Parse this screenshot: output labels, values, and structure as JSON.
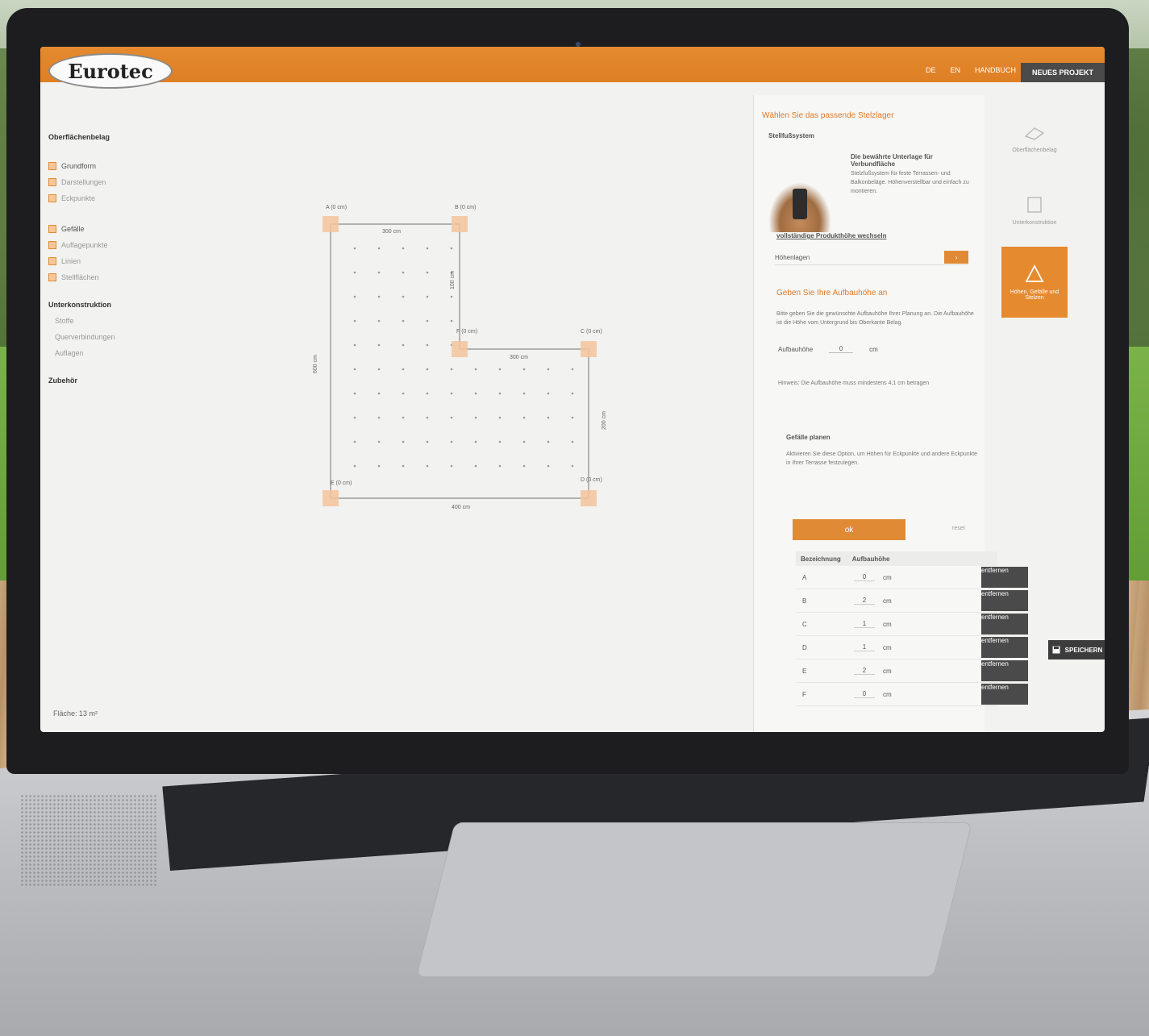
{
  "brand": {
    "logo_text": "Eurotec",
    "accent": "#e58a2f"
  },
  "header": {
    "links": [
      "DE",
      "EN",
      "HANDBUCH"
    ],
    "new_project": "NEUES PROJEKT"
  },
  "nav": {
    "sections": [
      {
        "heading": "Oberflächenbelag",
        "items": []
      },
      {
        "heading": "",
        "items": [
          {
            "label": "Grundform",
            "active": true
          },
          {
            "label": "Darstellungen",
            "active": false
          },
          {
            "label": "Eckpunkte",
            "active": false
          }
        ]
      },
      {
        "heading": "",
        "items": [
          {
            "label": "Gefälle",
            "active": true
          },
          {
            "label": "Auflagepunkte",
            "active": false
          },
          {
            "label": "Linien",
            "active": false
          },
          {
            "label": "Stellflächen",
            "active": false
          }
        ]
      },
      {
        "heading": "Unterkonstruktion",
        "items": [
          {
            "label": "Stoffe",
            "active": false
          },
          {
            "label": "Querverbindungen",
            "active": false
          },
          {
            "label": "Auflagen",
            "active": false
          }
        ]
      },
      {
        "heading": "Zubehör",
        "items": []
      }
    ],
    "area_label": "Fläche: 13 m²"
  },
  "drawing": {
    "corner_labels": [
      "A (0 cm)",
      "B (0 cm)",
      "C (0 cm)",
      "D (0 cm)",
      "E (0 cm)",
      "F (0 cm)"
    ],
    "dimensions": [
      "300 cm",
      "100 cm",
      "300 cm",
      "200 cm",
      "600 cm",
      "400 cm"
    ]
  },
  "panel": {
    "title": "Wählen Sie das passende Stelzlager",
    "subtitle": "Stellfußsystem",
    "product_heading": "Die bewährte Unterlage für Verbundfläche",
    "product_text": "Stelzfußsystem für feste Terrassen- und Balkonbeläge. Höhenverstellbar und einfach zu montieren.",
    "link": "vollständige Produkthöhe wechseln",
    "select_label": "Höhenlagen",
    "section2_title": "Geben Sie Ihre Aufbauhöhe an",
    "section2_text": "Bitte geben Sie die gewünschte Aufbauhöhe Ihrer Planung an. Die Aufbauhöhe ist die Höhe vom Untergrund bis Oberkante Belag.",
    "height_label": "Aufbauhöhe",
    "height_value": "0",
    "height_unit": "cm",
    "note": "Hinweis: Die Aufbauhöhe muss mindestens 4,1 cm betragen",
    "gefaelle_title": "Gefälle planen",
    "gefaelle_text": "Aktivieren Sie diese Option, um Höhen für Eckpunkte und andere Eckpunkte in Ihrer Terrasse festzulegen.",
    "plan_button": "ok",
    "reset_button": "reset",
    "table_headers": [
      "Bezeichnung",
      "Aufbauhöhe"
    ],
    "rows": [
      {
        "name": "A",
        "value": "0",
        "unit": "cm"
      },
      {
        "name": "B",
        "value": "2",
        "unit": "cm"
      },
      {
        "name": "C",
        "value": "1",
        "unit": "cm"
      },
      {
        "name": "D",
        "value": "1",
        "unit": "cm"
      },
      {
        "name": "E",
        "value": "2",
        "unit": "cm"
      },
      {
        "name": "F",
        "value": "0",
        "unit": "cm"
      }
    ],
    "remove_label": "entfernen"
  },
  "sidebar_tabs": [
    {
      "label": "Oberflächenbelag",
      "active": false
    },
    {
      "label": "Unterkonstruktion",
      "active": false
    },
    {
      "label": "Höhen, Gefälle und Stelzen",
      "active": true
    },
    {
      "label": "",
      "active": false
    },
    {
      "label": "",
      "active": false
    },
    {
      "label": "",
      "active": false
    }
  ],
  "save_label": "SPEICHERN"
}
